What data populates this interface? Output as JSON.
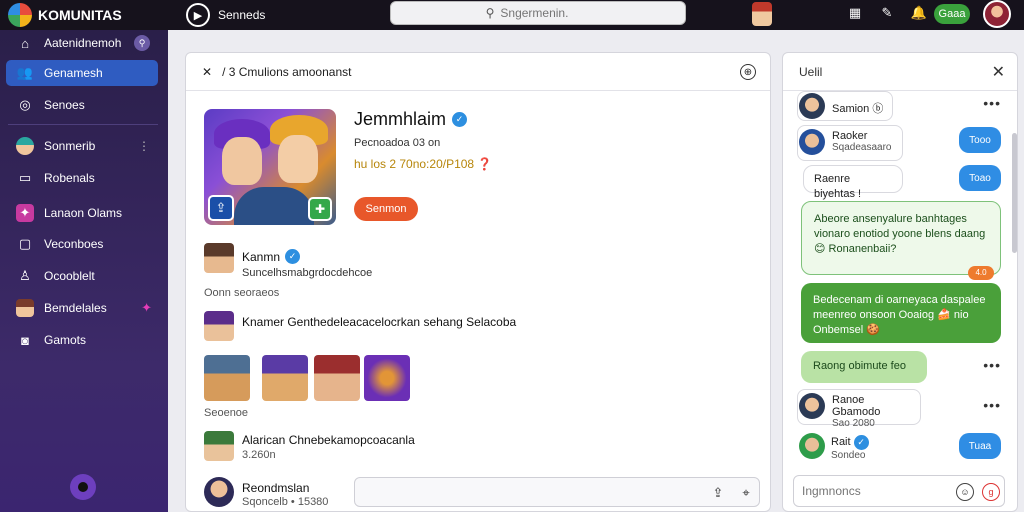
{
  "app": {
    "name": "KOMUNITAS"
  },
  "topbar": {
    "nav_label": "Senneds",
    "search_placeholder": "Sngermenin.",
    "green_button": "Gaaa"
  },
  "sidebar": {
    "items": [
      {
        "label": "Aatenidnemoh",
        "badge": "⚲"
      },
      {
        "label": "Genamesh"
      },
      {
        "label": "Senoes"
      },
      {
        "label": "Sonmerib"
      },
      {
        "label": "Robenals"
      },
      {
        "label": "Lanaon Olams"
      },
      {
        "label": "Veconboes"
      },
      {
        "label": "Ocooblelt"
      },
      {
        "label": "Bemdelales"
      },
      {
        "label": "Gamots"
      }
    ]
  },
  "main": {
    "header": "/ 3 Cmulions amoonanst",
    "profile": {
      "name": "Jemmhlaim",
      "subtitle": "Pecnoadoa 03 on",
      "stats": "hu los 2 70no:20/P108 ❓",
      "action": "Senmon"
    },
    "feed": [
      {
        "name": "Kanmn",
        "text": "Suncelhsmabgrdocdehcoe",
        "meta": "Oonn  seoraeos"
      },
      {
        "name": "Knamer Genthedeleacacelocrkan sehang Selacoba"
      },
      {
        "meta": "Seoenoe"
      },
      {
        "name": "Alarican Chnebekamopcoacanla",
        "meta": "3.260n"
      }
    ],
    "composer": {
      "name": "Reondmslan",
      "meta": "Sqoncelb • 15380"
    }
  },
  "chat": {
    "title": "Uelil",
    "messages": [
      {
        "name": "Samion ⓑ"
      },
      {
        "name": "Raoker",
        "sub": "Sqadeasaaro",
        "pill": "Tooo"
      },
      {
        "text": "Raenre biyehtas !",
        "pill": "Toao"
      },
      {
        "text": "Abeore ansenyalure banhtages vionaro enotiod yoone blens daang 😊 Ronanenbaii?",
        "badge": "4.0"
      },
      {
        "text": "Bedecenam di oarneyaca daspalee meenreo onsoon Ooaiog 🍰 nio Onbemsel 🍪"
      },
      {
        "text": "Raong obimute feo"
      },
      {
        "name": "Ranoe Gbamodo",
        "sub": "Sao 2080"
      },
      {
        "name": "Rait",
        "sub": "Sondeo",
        "pill": "Tuaa"
      }
    ],
    "input_placeholder": "Ingmnoncs"
  }
}
